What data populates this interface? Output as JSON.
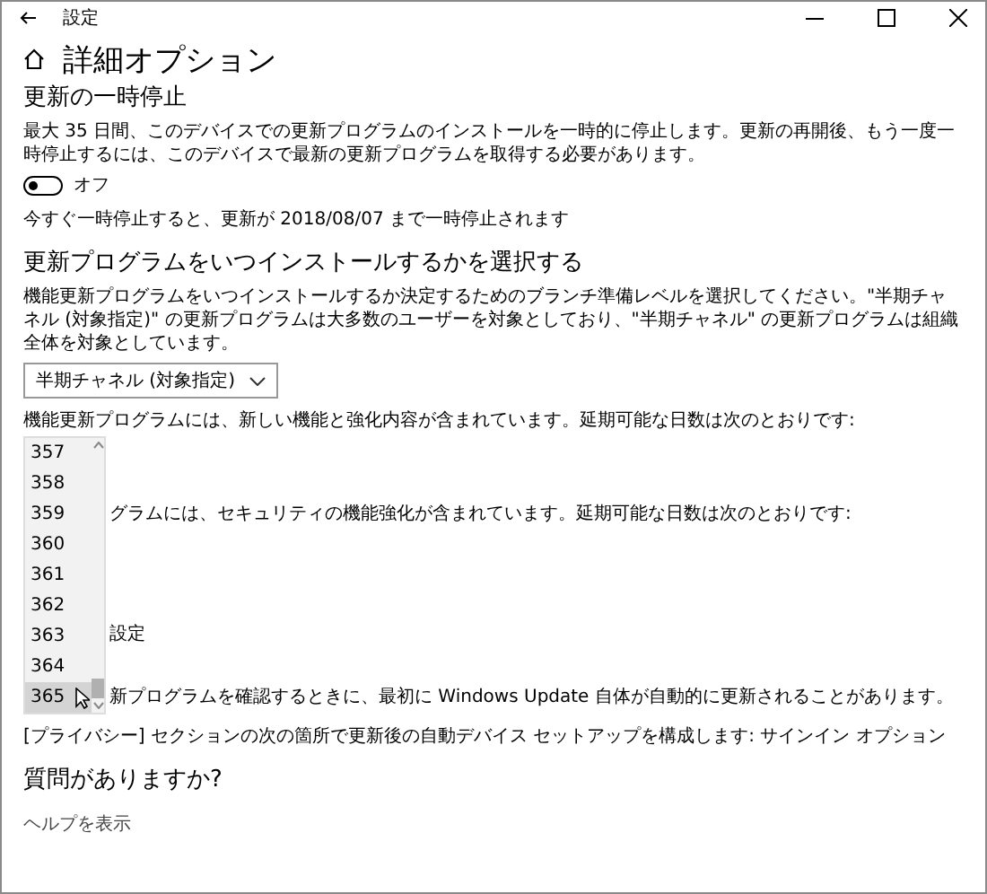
{
  "window": {
    "title": "設定"
  },
  "page": {
    "title": "詳細オプション"
  },
  "pause": {
    "heading": "更新の一時停止",
    "description": "最大 35 日間、このデバイスでの更新プログラムのインストールを一時的に停止します。更新の再開後、もう一度一時停止するには、このデバイスで最新の更新プログラムを取得する必要があります。",
    "toggle": {
      "on": false,
      "label": "オフ"
    },
    "note": "今すぐ一時停止すると、更新が 2018/08/07 まで一時停止されます"
  },
  "schedule": {
    "heading": "更新プログラムをいつインストールするかを選択する",
    "description": "機能更新プログラムをいつインストールするか決定するためのブランチ準備レベルを選択してください。\"半期チャネル (対象指定)\" の更新プログラムは大多数のユーザーを対象としており、\"半期チャネル\" の更新プログラムは組織全体を対象としています。",
    "dropdown": {
      "value": "半期チャネル (対象指定)"
    },
    "feature_text": "機能更新プログラムには、新しい機能と強化内容が含まれています。延期可能な日数は次のとおりです:",
    "days_list": [
      {
        "label": "357",
        "selected": false
      },
      {
        "label": "358",
        "selected": false
      },
      {
        "label": "359",
        "selected": false
      },
      {
        "label": "360",
        "selected": false
      },
      {
        "label": "361",
        "selected": false
      },
      {
        "label": "362",
        "selected": false
      },
      {
        "label": "363",
        "selected": false
      },
      {
        "label": "364",
        "selected": false
      },
      {
        "label": "365",
        "selected": true
      }
    ],
    "covered_texts": [
      "グラムには、セキュリティの機能強化が含まれています。延期可能な日数は次のとおりです:",
      "設定",
      "新プログラムを確認するときに、最初に Windows Update 自体が自動的に更新されることがあります。"
    ]
  },
  "privacy_text": "[プライバシー] セクションの次の箇所で更新後の自動デバイス セットアップを構成します: サインイン オプション",
  "help": {
    "heading": "質問がありますか?",
    "link": "ヘルプを表示"
  }
}
